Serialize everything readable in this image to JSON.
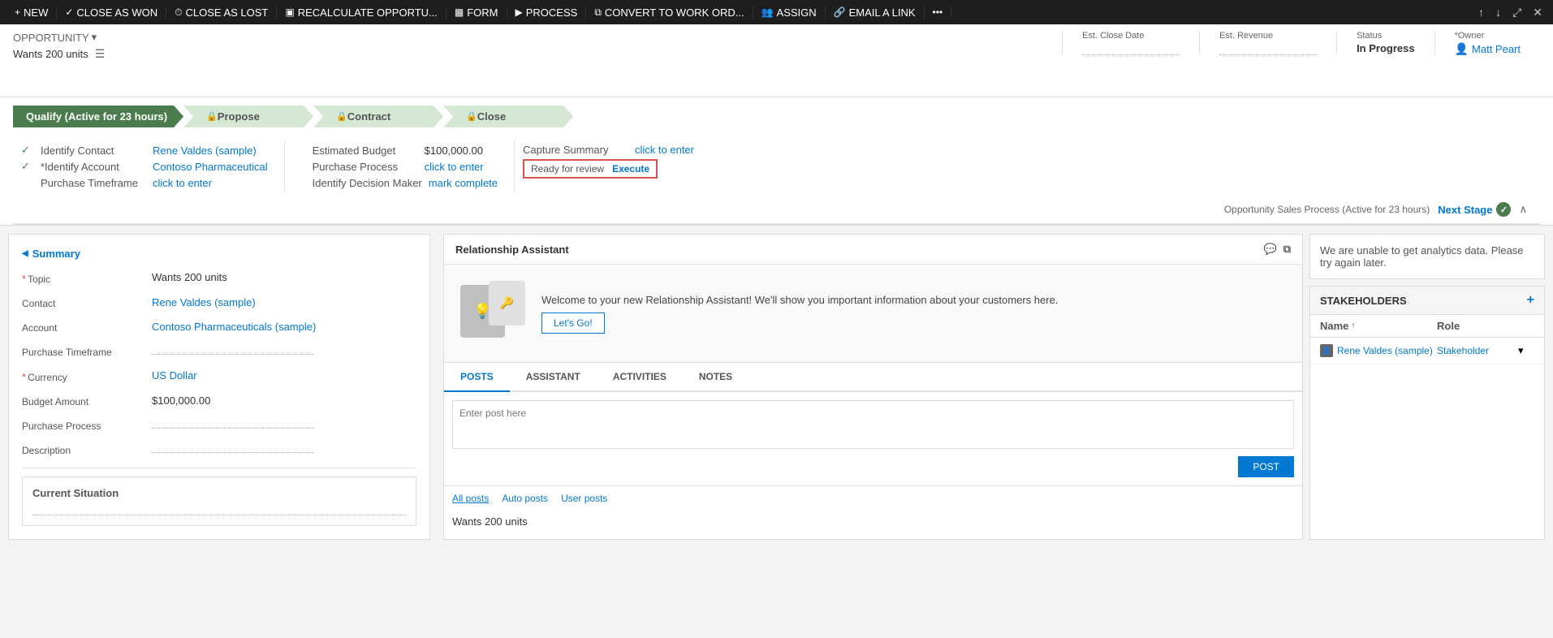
{
  "toolbar": {
    "items": [
      {
        "id": "new",
        "icon": "+",
        "label": "NEW"
      },
      {
        "id": "close-as-won",
        "icon": "✓",
        "label": "CLOSE AS WON"
      },
      {
        "id": "close-as-lost",
        "icon": "⏱",
        "label": "CLOSE AS LOST"
      },
      {
        "id": "recalculate",
        "icon": "▣",
        "label": "RECALCULATE OPPORTU..."
      },
      {
        "id": "form",
        "icon": "▦",
        "label": "FORM"
      },
      {
        "id": "process",
        "icon": "▶",
        "label": "PROCESS"
      },
      {
        "id": "convert",
        "icon": "⧉",
        "label": "CONVERT TO WORK ORD..."
      },
      {
        "id": "assign",
        "icon": "👥",
        "label": "ASSIGN"
      },
      {
        "id": "email",
        "icon": "🔗",
        "label": "EMAIL A LINK"
      },
      {
        "id": "more",
        "icon": "•••",
        "label": ""
      }
    ],
    "right_buttons": [
      "↑",
      "↓",
      "⤢",
      "✕"
    ]
  },
  "header": {
    "breadcrumb": "OPPORTUNITY",
    "title": "Wants 200 units",
    "est_close_date_label": "Est. Close Date",
    "est_close_date_value": "",
    "est_revenue_label": "Est. Revenue",
    "est_revenue_value": "",
    "status_label": "Status",
    "status_value": "In Progress",
    "owner_label": "*Owner",
    "owner_value": "Matt Peart"
  },
  "stages": [
    {
      "id": "qualify",
      "label": "Qualify (Active for 23 hours)",
      "state": "active",
      "locked": false
    },
    {
      "id": "propose",
      "label": "Propose",
      "state": "inactive",
      "locked": true
    },
    {
      "id": "contract",
      "label": "Contract",
      "state": "inactive",
      "locked": true
    },
    {
      "id": "close",
      "label": "Close",
      "state": "inactive",
      "locked": true
    }
  ],
  "process_fields": {
    "col1": [
      {
        "checked": true,
        "label": "Identify Contact",
        "value": "Rene Valdes (sample)",
        "type": "link"
      },
      {
        "checked": true,
        "label": "*Identify Account",
        "value": "Contoso Pharmaceutical",
        "type": "link"
      },
      {
        "checked": false,
        "label": "Purchase Timeframe",
        "value": "click to enter",
        "type": "action"
      }
    ],
    "col2": [
      {
        "checked": false,
        "label": "Estimated Budget",
        "value": "$100,000.00",
        "type": "text"
      },
      {
        "checked": false,
        "label": "Purchase Process",
        "value": "click to enter",
        "type": "action"
      },
      {
        "checked": false,
        "label": "Identify Decision Maker",
        "value": "mark complete",
        "type": "action"
      }
    ],
    "col3": [
      {
        "label": "Capture Summary",
        "value": "click to enter",
        "type": "action"
      },
      {
        "label": "Ready for review",
        "value": "Execute",
        "type": "highlight"
      }
    ]
  },
  "process_bottom": {
    "label": "Opportunity Sales Process (Active for 23 hours)",
    "next_stage": "Next Stage"
  },
  "summary": {
    "title": "Summary",
    "fields": [
      {
        "label": "*Topic",
        "value": "Wants 200 units",
        "type": "text",
        "required": true
      },
      {
        "label": "Contact",
        "value": "Rene Valdes (sample)",
        "type": "link",
        "required": false
      },
      {
        "label": "Account",
        "value": "Contoso Pharmaceuticals (sample)",
        "type": "link",
        "required": false
      },
      {
        "label": "Purchase Timeframe",
        "value": "",
        "type": "dotted",
        "required": false
      },
      {
        "label": "*Currency",
        "value": "US Dollar",
        "type": "link",
        "required": true
      },
      {
        "label": "Budget Amount",
        "value": "$100,000.00",
        "type": "text",
        "required": false
      },
      {
        "label": "Purchase Process",
        "value": "",
        "type": "dotted",
        "required": false
      },
      {
        "label": "Description",
        "value": "",
        "type": "dotted",
        "required": false
      }
    ],
    "sub_section": {
      "title": "Current Situation",
      "value": ""
    }
  },
  "relationship_assistant": {
    "title": "Relationship Assistant",
    "welcome_text": "Welcome to your new Relationship Assistant! We'll show you important information about your customers here.",
    "lets_go": "Let's Go!",
    "icons": [
      "💬",
      "⧉"
    ]
  },
  "posts_tabs": [
    {
      "id": "posts",
      "label": "POSTS",
      "active": true
    },
    {
      "id": "assistant",
      "label": "ASSISTANT",
      "active": false
    },
    {
      "id": "activities",
      "label": "ACTIVITIES",
      "active": false
    },
    {
      "id": "notes",
      "label": "NOTES",
      "active": false
    }
  ],
  "post_input": {
    "placeholder": "Enter post here",
    "button": "POST"
  },
  "post_filters": [
    {
      "id": "all",
      "label": "All posts",
      "active": true
    },
    {
      "id": "auto",
      "label": "Auto posts",
      "active": false
    },
    {
      "id": "user",
      "label": "User posts",
      "active": false
    }
  ],
  "post_preview": "Wants 200 units",
  "analytics": {
    "message": "We are unable to get analytics data. Please try again later."
  },
  "stakeholders": {
    "title": "STAKEHOLDERS",
    "col_name": "Name",
    "col_role": "Role",
    "rows": [
      {
        "name": "Rene Valdes (sample)",
        "role": "Stakeholder"
      }
    ]
  }
}
